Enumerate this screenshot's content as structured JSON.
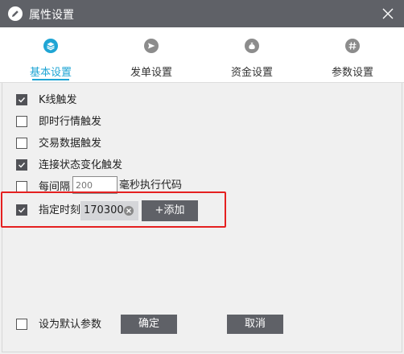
{
  "window": {
    "title": "属性设置"
  },
  "tabs": [
    {
      "label": "基本设置",
      "icon": "stack-icon",
      "active": true
    },
    {
      "label": "发单设置",
      "icon": "send-icon",
      "active": false
    },
    {
      "label": "资金设置",
      "icon": "money-bag-icon",
      "active": false
    },
    {
      "label": "参数设置",
      "icon": "hash-icon",
      "active": false
    }
  ],
  "options": [
    {
      "label": "K线触发",
      "checked": true
    },
    {
      "label": "即时行情触发",
      "checked": false
    },
    {
      "label": "交易数据触发",
      "checked": false
    },
    {
      "label": "连接状态变化触发",
      "checked": true
    },
    {
      "label": "每间隔",
      "checked": false,
      "placeholder": "200",
      "suffix": "毫秒执行代码"
    },
    {
      "label": "指定时刻",
      "checked": true,
      "time_value": "170300",
      "add_label": "+添加"
    }
  ],
  "footer": {
    "default_params_label": "设为默认参数",
    "default_params_checked": false,
    "confirm_label": "确定",
    "cancel_label": "取消"
  },
  "colors": {
    "titlebar": "#5f6167",
    "accent": "#1fa5d4",
    "highlight_box": "#e52020",
    "button": "#5f6167"
  }
}
